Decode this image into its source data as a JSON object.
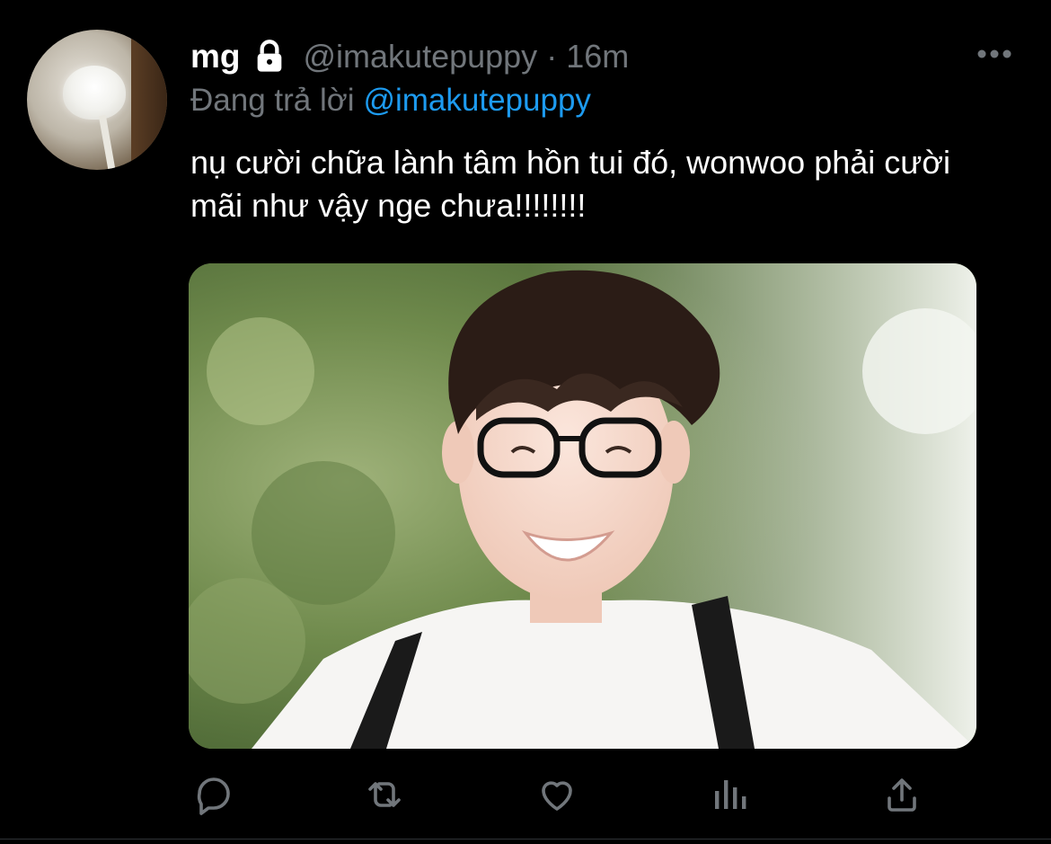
{
  "tweet": {
    "display_name": "mg",
    "handle": "@imakutepuppy",
    "separator": "·",
    "time": "16m",
    "reply_prefix": "Đang trả lời",
    "reply_to": "@imakutepuppy",
    "text": "nụ cười chữa lành tâm hồn tui đó, wonwoo phải cười mãi như vậy nge chưa!!!!!!!!"
  },
  "icons": {
    "lock": "lock-icon",
    "more": "more-icon",
    "reply": "reply-icon",
    "retweet": "retweet-icon",
    "like": "heart-icon",
    "views": "analytics-icon",
    "share": "share-icon"
  },
  "colors": {
    "background": "#000000",
    "text_primary": "#ffffff",
    "text_secondary": "#71767b",
    "accent": "#1d9bf0"
  }
}
